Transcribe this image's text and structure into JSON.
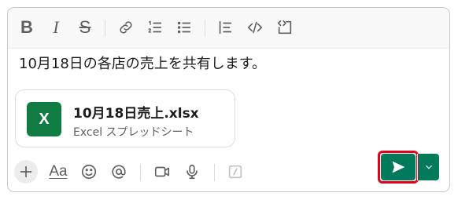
{
  "composer": {
    "message_text": "10月18日の各店の売上を共有します。",
    "attachment": {
      "file_name": "10月18日売上.xlsx",
      "file_type": "Excel スプレッドシート",
      "icon_letter": "X",
      "icon_color": "#107c41"
    }
  },
  "toolbar": {
    "bold_label": "B",
    "italic_label": "I",
    "strike_label": "S",
    "items": [
      "bold-icon",
      "italic-icon",
      "strikethrough-icon",
      "link-icon",
      "ordered-list-icon",
      "bulleted-list-icon",
      "blockquote-icon",
      "code-icon",
      "code-block-icon"
    ]
  },
  "bottom_bar": {
    "format_label": "Aa",
    "items": [
      "plus-icon",
      "text-format-icon",
      "emoji-icon",
      "mention-icon",
      "video-icon",
      "microphone-icon",
      "slash-command-icon"
    ]
  },
  "send": {
    "accent_color": "#007a5a",
    "highlight_color": "#e0001b"
  }
}
